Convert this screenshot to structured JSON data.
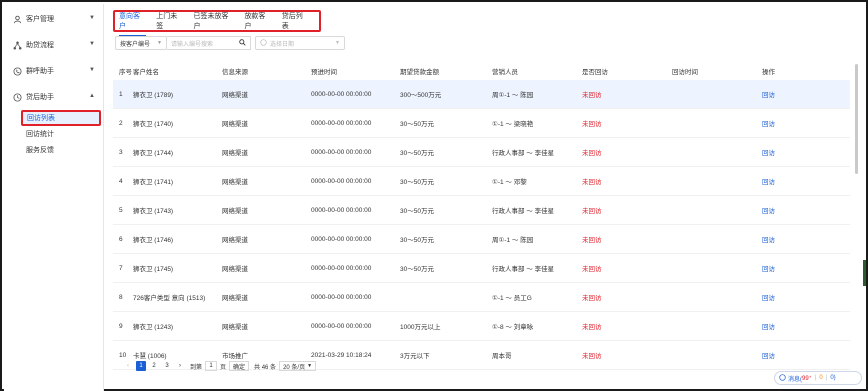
{
  "sidebar": {
    "items": [
      {
        "icon": "user-icon",
        "label": "客户管理"
      },
      {
        "icon": "flow-icon",
        "label": "助贷流程"
      },
      {
        "icon": "phone-icon",
        "label": "群呼助手"
      },
      {
        "icon": "clock-icon",
        "label": "贷后助手"
      }
    ],
    "sub": [
      "回访列表",
      "回访统计",
      "服务反馈"
    ]
  },
  "tabs": [
    "意向客户",
    "上门未签",
    "已签未放客户",
    "放款客户",
    "贷后列表"
  ],
  "toolbar": {
    "select_label": "按客户编号",
    "search_placeholder": "请输入编号搜索",
    "date_placeholder": "选择日期"
  },
  "table": {
    "headers": [
      "序号",
      "客户姓名",
      "信息来源",
      "预进时间",
      "期望贷款金额",
      "营销人员",
      "是否回访",
      "回访时间",
      "操作"
    ],
    "rows": [
      {
        "no": "1",
        "name": "狮衣卫 (1789)",
        "src": "网络渠道",
        "time": "0000-00-00 00:00:00",
        "amt": "300～500万元",
        "sales": "周①-1 ～ 陈园",
        "status": "未回访",
        "vtime": "",
        "op": "回访"
      },
      {
        "no": "2",
        "name": "狮衣卫 (1740)",
        "src": "网络渠道",
        "time": "0000-00-00 00:00:00",
        "amt": "30～50万元",
        "sales": "①-1 ～ 梁晓艳",
        "status": "未回访",
        "vtime": "",
        "op": "回访"
      },
      {
        "no": "3",
        "name": "狮衣卫 (1744)",
        "src": "网络渠道",
        "time": "0000-00-00 00:00:00",
        "amt": "30～50万元",
        "sales": "行政人事部 ～ 李佳星",
        "status": "未回访",
        "vtime": "",
        "op": "回访"
      },
      {
        "no": "4",
        "name": "狮衣卫 (1741)",
        "src": "网络渠道",
        "time": "0000-00-00 00:00:00",
        "amt": "30～50万元",
        "sales": "①-1 ～ 邓黎",
        "status": "未回访",
        "vtime": "",
        "op": "回访"
      },
      {
        "no": "5",
        "name": "狮衣卫 (1743)",
        "src": "网络渠道",
        "time": "0000-00-00 00:00:00",
        "amt": "30～50万元",
        "sales": "行政人事部 ～ 李佳星",
        "status": "未回访",
        "vtime": "",
        "op": "回访"
      },
      {
        "no": "6",
        "name": "狮衣卫 (1746)",
        "src": "网络渠道",
        "time": "0000-00-00 00:00:00",
        "amt": "30～50万元",
        "sales": "周①-1 ～ 陈园",
        "status": "未回访",
        "vtime": "",
        "op": "回访"
      },
      {
        "no": "7",
        "name": "狮衣卫 (1745)",
        "src": "网络渠道",
        "time": "0000-00-00 00:00:00",
        "amt": "30～50万元",
        "sales": "行政人事部 ～ 李佳星",
        "status": "未回访",
        "vtime": "",
        "op": "回访"
      },
      {
        "no": "8",
        "name": "726客户类型 意向 (1513)",
        "src": "网络渠道",
        "time": "0000-00-00 00:00:00",
        "amt": "",
        "sales": "①-1 ～ 员工G",
        "status": "未回访",
        "vtime": "",
        "op": "回访"
      },
      {
        "no": "9",
        "name": "狮衣卫 (1243)",
        "src": "网络渠道",
        "time": "0000-00-00 00:00:00",
        "amt": "1000万元以上",
        "sales": "①-8 ～ 刘章咏",
        "status": "未回访",
        "vtime": "",
        "op": "回访"
      },
      {
        "no": "10",
        "name": "卡慧 (1006)",
        "src": "市场推广",
        "time": "2021-03-29 10:18:24",
        "amt": "3万元以下",
        "sales": "周本哥",
        "status": "未回访",
        "vtime": "",
        "op": "回访"
      }
    ]
  },
  "pager": {
    "pages": [
      "1",
      "2",
      "3"
    ],
    "goto": "到第",
    "page_input": "1",
    "page_unit": "页",
    "confirm": "确定",
    "total": "共 46 条",
    "size": "20 条/页"
  },
  "msg": {
    "label": "消息(",
    "a": "99⁺",
    "b": "0",
    "c": "0",
    "end": ")"
  }
}
